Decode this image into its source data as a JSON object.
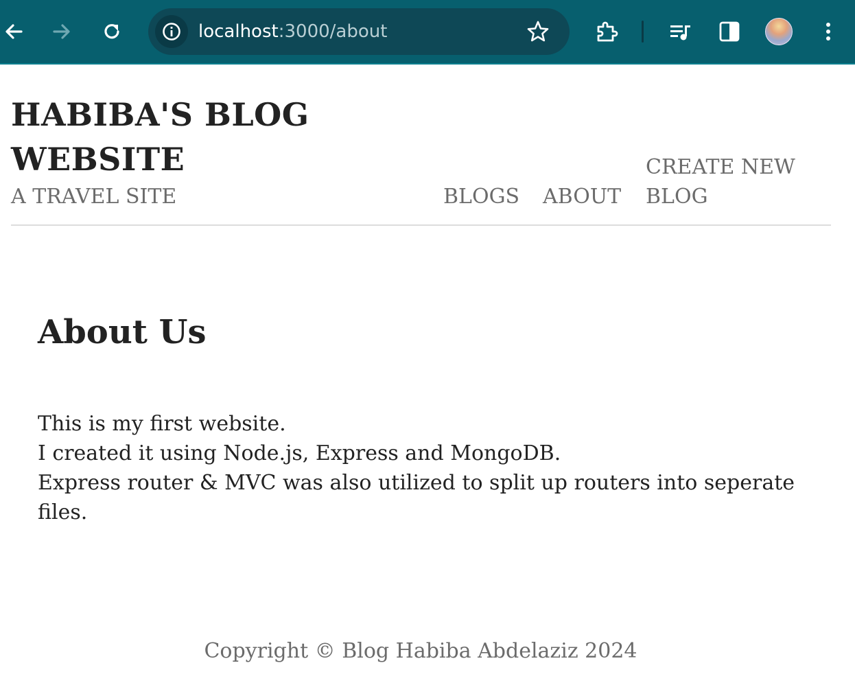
{
  "browser": {
    "url_host": "localhost",
    "url_rest": ":3000/about",
    "icons": {
      "back": "back-arrow-icon",
      "forward": "forward-arrow-icon",
      "reload": "reload-icon",
      "site_info": "info-icon",
      "bookmark": "star-icon",
      "extensions": "puzzle-icon",
      "media": "playlist-icon",
      "side_panel": "side-panel-icon",
      "profile": "avatar",
      "menu": "kebab-menu-icon"
    },
    "colors": {
      "toolbar": "#075f6e",
      "omnibox": "#0e4856"
    }
  },
  "site": {
    "title": "HABIBA'S BLOG WEBSITE",
    "subtitle": "A TRAVEL SITE",
    "nav": {
      "blogs": "BLOGS",
      "about": "ABOUT",
      "create": "CREATE NEW BLOG"
    }
  },
  "about": {
    "heading": "About Us",
    "lines": [
      "This is my first website.",
      "I created it using Node.js, Express and MongoDB.",
      "Express router & MVC was also utilized to split up routers into seperate files."
    ]
  },
  "footer": {
    "text": "Copyright © Blog Habiba Abdelaziz 2024"
  }
}
